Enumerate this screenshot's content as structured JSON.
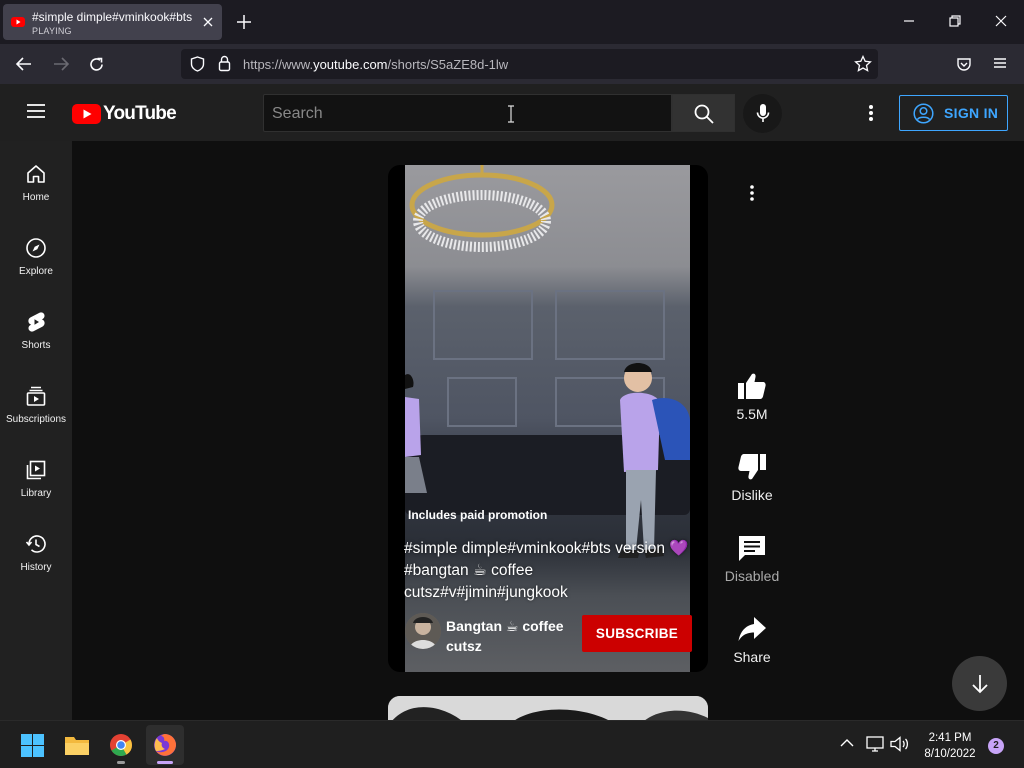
{
  "browser": {
    "tab": {
      "title": "#simple dimple#vminkook#bts",
      "status": "PLAYING"
    },
    "url": {
      "prefix": "https://www.",
      "domain": "youtube.com",
      "path": "/shorts/S5aZE8d-1lw"
    }
  },
  "youtube": {
    "logo_text": "YouTube",
    "search_placeholder": "Search",
    "sign_in": "SIGN IN",
    "sidebar": [
      {
        "label": "Home",
        "icon": "home-icon"
      },
      {
        "label": "Explore",
        "icon": "compass-icon"
      },
      {
        "label": "Shorts",
        "icon": "shorts-icon"
      },
      {
        "label": "Subscriptions",
        "icon": "subscriptions-icon"
      },
      {
        "label": "Library",
        "icon": "library-icon"
      },
      {
        "label": "History",
        "icon": "history-icon"
      }
    ],
    "short": {
      "paid_promotion": "Includes paid promotion",
      "title": "#simple dimple#vminkook#bts version 💜 #bangtan ☕ coffee cutsz#v#jimin#jungkook",
      "channel_name": "Bangtan ☕ coffee cutsz",
      "subscribe": "SUBSCRIBE"
    },
    "actions": {
      "like_count": "5.5M",
      "dislike": "Dislike",
      "comments": "Disabled",
      "share": "Share"
    },
    "colors": {
      "brand_red": "#ff0000",
      "subscribe_red": "#cc0000",
      "sign_in_blue": "#3ea6ff"
    }
  },
  "taskbar": {
    "time": "2:41 PM",
    "date": "8/10/2022",
    "notifications": "2"
  }
}
